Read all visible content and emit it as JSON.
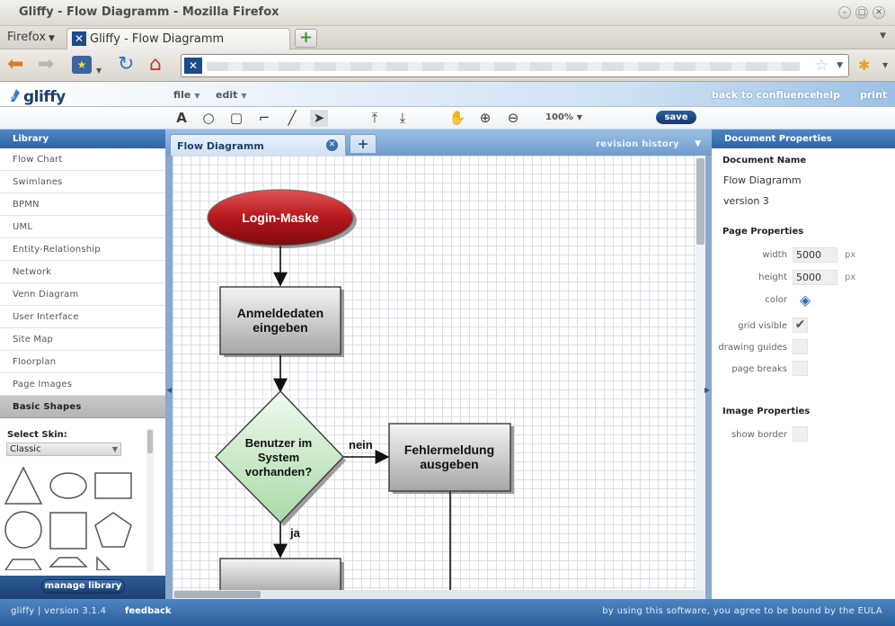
{
  "window": {
    "title": "Gliffy - Flow Diagramm - Mozilla Firefox"
  },
  "browser": {
    "menu_label": "Firefox",
    "tab_title": "Gliffy - Flow Diagramm"
  },
  "gliffy": {
    "logo": "gliffy",
    "menus": [
      "file",
      "edit"
    ],
    "links": {
      "back": "back to confluence",
      "help": "help",
      "print": "print"
    },
    "zoom": "100%",
    "save_label": "save"
  },
  "library": {
    "header": "Library",
    "items": [
      "Flow Chart",
      "Swimlanes",
      "BPMN",
      "UML",
      "Entity-Relationship",
      "Network",
      "Venn Diagram",
      "User Interface",
      "Site Map",
      "Floorplan",
      "Page Images",
      "Basic Shapes"
    ],
    "selected": "Basic Shapes",
    "skin_label": "Select Skin:",
    "skin_value": "Classic",
    "manage_label": "manage library"
  },
  "canvas": {
    "tab_label": "Flow Diagramm",
    "add_tab": "+",
    "revision_label": "revision history",
    "diagram": {
      "start": "Login-Maske",
      "step1_line1": "Anmeldedaten",
      "step1_line2": "eingeben",
      "decision_line1": "Benutzer im",
      "decision_line2": "System",
      "decision_line3": "vorhanden?",
      "no_label": "nein",
      "yes_label": "ja",
      "error_line1": "Fehlermeldung",
      "error_line2": "ausgeben"
    }
  },
  "document": {
    "header": "Document Properties",
    "name_label": "Document Name",
    "name_value": "Flow Diagramm",
    "version": "version 3",
    "page_properties": "Page Properties",
    "width_label": "width",
    "width_value": "5000",
    "height_label": "height",
    "height_value": "5000",
    "unit": "px",
    "color_label": "color",
    "grid_visible_label": "grid visible",
    "grid_visible": true,
    "drawing_guides_label": "drawing guides",
    "drawing_guides": false,
    "page_breaks_label": "page breaks",
    "page_breaks": false,
    "image_properties": "Image Properties",
    "show_border_label": "show border",
    "show_border": false
  },
  "status": {
    "version": "gliffy | version 3.1.4",
    "feedback": "feedback",
    "eula": "by using this software, you agree to be bound by the EULA"
  },
  "colors": {
    "accent": "#2d63a3",
    "start_node": "#a60f12",
    "decision": "#bfe4bd",
    "process": "#b3b3b3"
  }
}
